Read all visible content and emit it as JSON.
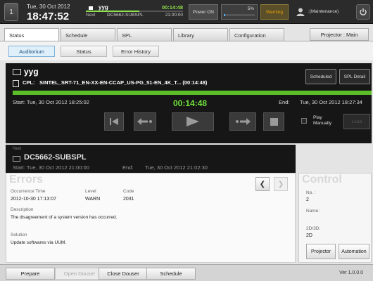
{
  "topbar": {
    "screen_number": "1",
    "date": "Tue, 30 Oct 2012",
    "time": "18:47:52",
    "now_title": "yyg",
    "now_elapsed": "00:14:48",
    "now_progress": 0.55,
    "next_label": "Next",
    "next_title": "DC5662-SUBSPL",
    "next_time": "21:00:00",
    "power_label": "Power ON",
    "lamp_percent": "5%",
    "lamp_fraction": 0.05,
    "warning_label": "Warning",
    "user_label": ":(Maintenance)",
    "colors": {
      "accent_green": "#6ee03a",
      "warning": "#e6a000",
      "lamp": "#4cb3ff"
    }
  },
  "main_tabs": [
    {
      "label": "Status",
      "active": true
    },
    {
      "label": "Schedule",
      "active": false
    },
    {
      "label": "SPL",
      "active": false
    },
    {
      "label": "Library",
      "active": false
    },
    {
      "label": "Configuration",
      "active": false
    }
  ],
  "projector_main_label": "Projector : Main",
  "sub_tabs": [
    {
      "label": "Auditorium",
      "active": true
    },
    {
      "label": "Status",
      "active": false
    },
    {
      "label": "Error History",
      "active": false
    }
  ],
  "current": {
    "title": "yyg",
    "cpl_label": "CPL:",
    "cpl_name": "SINTEL_SRT-71_EN-XX-EN-CCAP_US-PG_51-EN_4K_T...  (00:14:48)",
    "scheduled_label": "Scheduled",
    "spl_detail_label": "SPL Detail",
    "progress": 1.0,
    "start_text": "Start:  Tue, 30 Oct 2012 18:25:02",
    "elapsed": "00:14:48",
    "end_label": "End:",
    "end_text": "Tue, 30 Oct 2012 18:27:34",
    "play_manually_label": "Play Manually",
    "load_label": "Load"
  },
  "next": {
    "small_label": "Next",
    "title": "DC5662-SUBSPL",
    "start_text": "Start:   Tue, 30 Oct 2012 21:00:00",
    "end_label": "End:",
    "end_text": "Tue, 30 Oct 2012 21:02:30"
  },
  "errors": {
    "heading": "Errors",
    "occurrence_label": "Occurrence Time",
    "occurrence_value": "2012-10-30 17:13:07",
    "level_label": "Level",
    "level_value": "WARN",
    "code_label": "Code",
    "code_value": "2031",
    "description_label": "Description",
    "description_value": "The disagreement of a system version has occurred.",
    "solution_label": "Solution",
    "solution_value": "Update softwares via UUM."
  },
  "control": {
    "heading": "Control",
    "no_label": "No. :",
    "no_value": "2",
    "name_label": "Name:",
    "mode_label": "2D/3D:",
    "mode_value": "2D",
    "projector_label": "Projector",
    "automation_label": "Automation"
  },
  "bottom": {
    "prepare_label": "Prepare",
    "open_douser_label": "Open Douser",
    "close_douser_label": "Close Douser",
    "schedule_label": "Schedule",
    "version": "Ver 1.0.0.0"
  }
}
